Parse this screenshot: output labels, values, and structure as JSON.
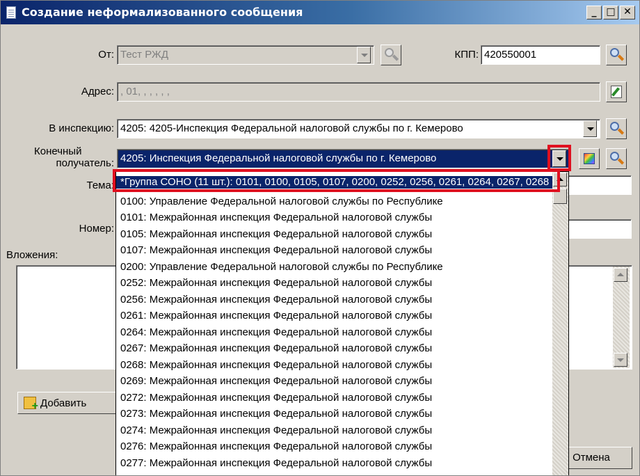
{
  "window": {
    "title": "Создание неформализованного сообщения"
  },
  "form": {
    "from_label": "От:",
    "from_value": "Тест РЖД",
    "kpp_label": "КПП:",
    "kpp_value": "420550001",
    "address_label": "Адрес:",
    "address_value": ", 01, , , , , ,",
    "inspection_label": "В инспекцию:",
    "inspection_value": "4205: 4205-Инспекция Федеральной налоговой службы по г. Кемерово",
    "recipient_label_line1": "Конечный",
    "recipient_label_line2": "получатель:",
    "recipient_value": "4205: Инспекция Федеральной налоговой службы по г. Кемерово",
    "subject_label": "Тема:",
    "number_label": "Номер:",
    "attachments_label": "Вложения:",
    "add_button_label": "Добавить",
    "cancel_button_label": "Отмена"
  },
  "dropdown": {
    "items": [
      "*Группа СОНО (11 шт.): 0101, 0100, 0105, 0107, 0200, 0252, 0256, 0261, 0264, 0267, 0268",
      "0100: Управление Федеральной налоговой службы по Республике",
      "0101: Межрайонная инспекция Федеральной налоговой службы",
      "0105: Межрайонная инспекция Федеральной налоговой службы",
      "0107: Межрайонная инспекция Федеральной налоговой службы",
      "0200: Управление Федеральной налоговой службы по Республике",
      "0252: Межрайонная инспекция Федеральной налоговой службы",
      "0256: Межрайонная инспекция Федеральной налоговой службы",
      "0261: Межрайонная инспекция Федеральной налоговой службы",
      "0264: Межрайонная инспекция Федеральной налоговой службы",
      "0267: Межрайонная инспекция Федеральной налоговой службы",
      "0268: Межрайонная инспекция Федеральной налоговой службы",
      "0269: Межрайонная инспекция Федеральной налоговой службы",
      "0272: Межрайонная инспекция Федеральной налоговой службы",
      "0273: Межрайонная инспекция Федеральной налоговой службы",
      "0274: Межрайонная инспекция Федеральной налоговой службы",
      "0276: Межрайонная инспекция Федеральной налоговой службы",
      "0277: Межрайонная инспекция Федеральной налоговой службы"
    ],
    "selected_index": 0
  },
  "colors": {
    "highlight": "#e01020",
    "selection": "#0a246a",
    "face": "#d4d0c8"
  }
}
